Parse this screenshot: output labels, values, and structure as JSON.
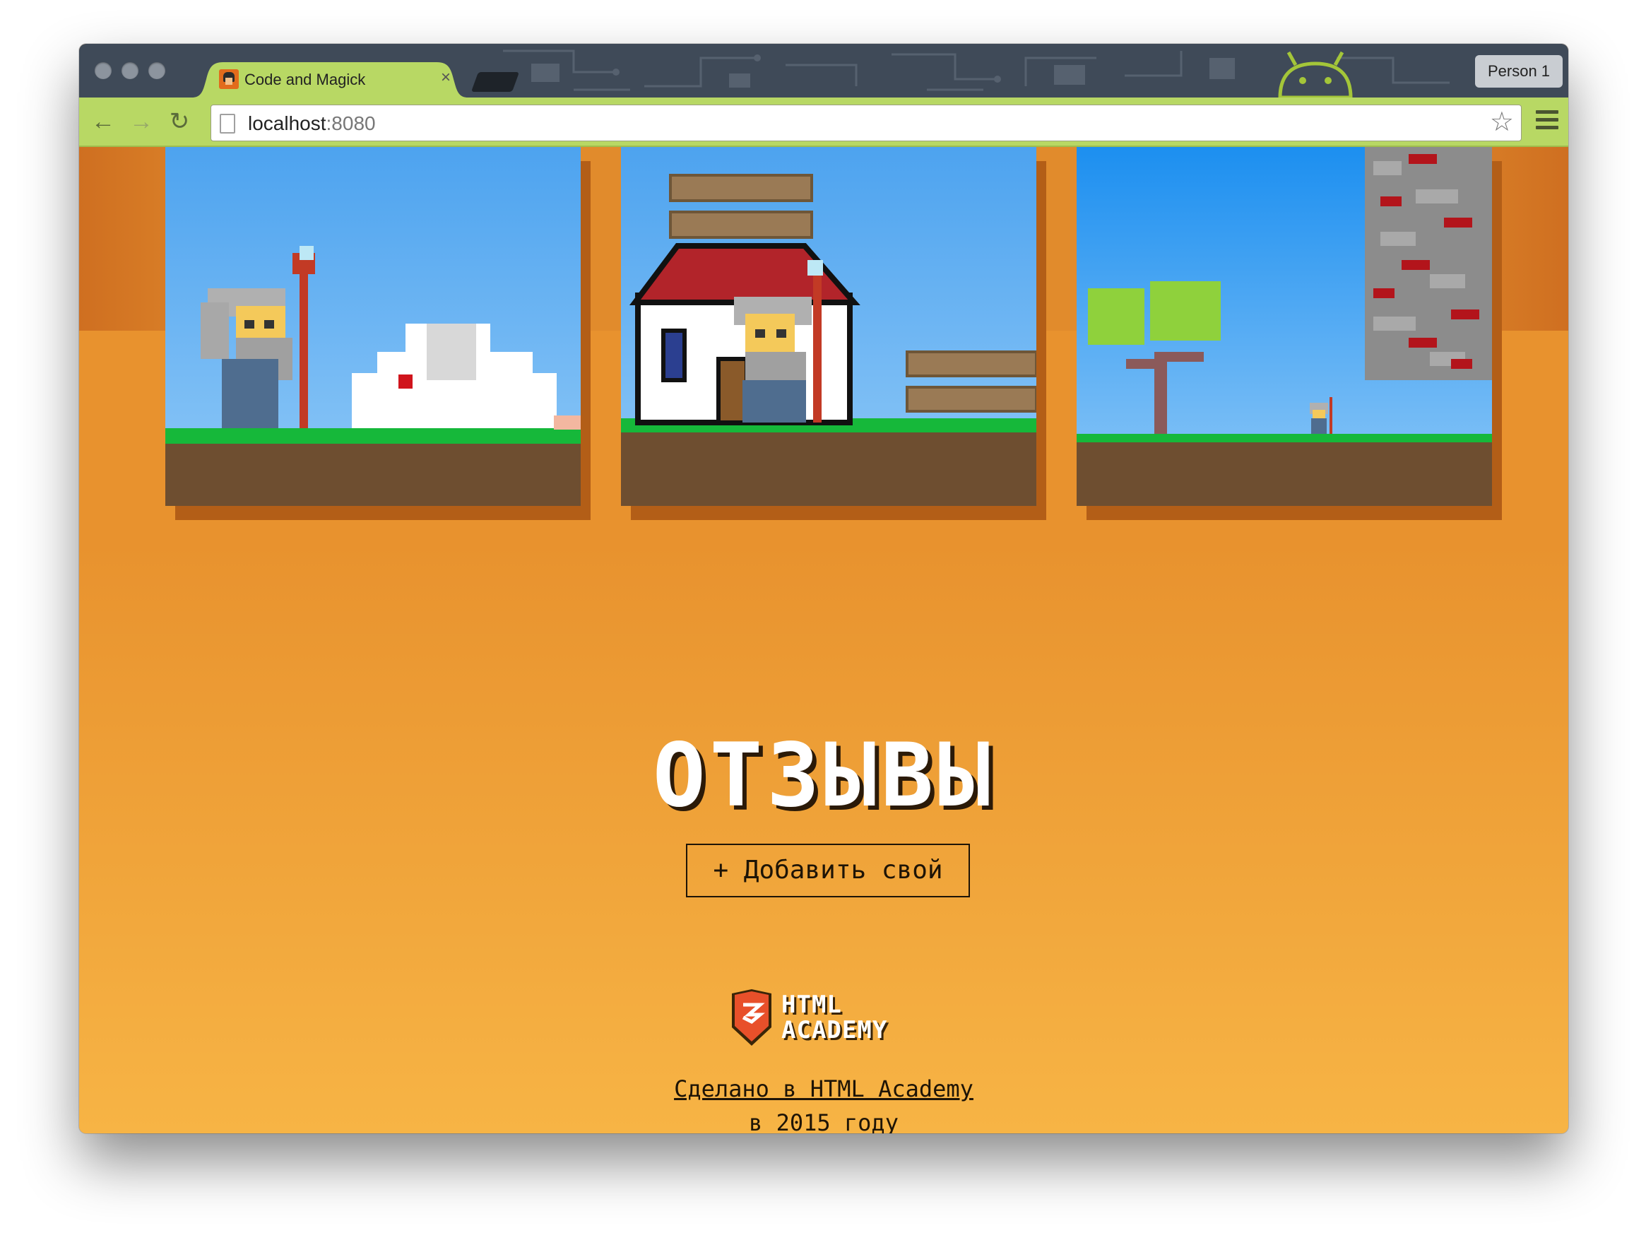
{
  "browser": {
    "tab_title": "Code and Magick",
    "tab_close": "×",
    "profile": "Person 1",
    "url_host": "localhost",
    "url_port": ":8080",
    "back_icon": "←",
    "forward_icon": "→",
    "reload_icon": "↻",
    "star_icon": "☆"
  },
  "page": {
    "screenshots": [
      {
        "scene": "wizard-with-cloud"
      },
      {
        "scene": "wizard-at-house"
      },
      {
        "scene": "wizard-near-tree-and-wall"
      }
    ],
    "reviews_title": "ОТЗЫВЫ",
    "add_review_button": "+ Добавить свой",
    "logo_line1": "HTML",
    "logo_line2": "ACADEMY",
    "made_in": "Сделано в HTML Academy",
    "year": "в 2015 году"
  },
  "colors": {
    "tab_accent": "#b8d864",
    "page_orange": "#e8922e",
    "page_orange_light": "#f7b445",
    "text_dark": "#1e1406"
  }
}
